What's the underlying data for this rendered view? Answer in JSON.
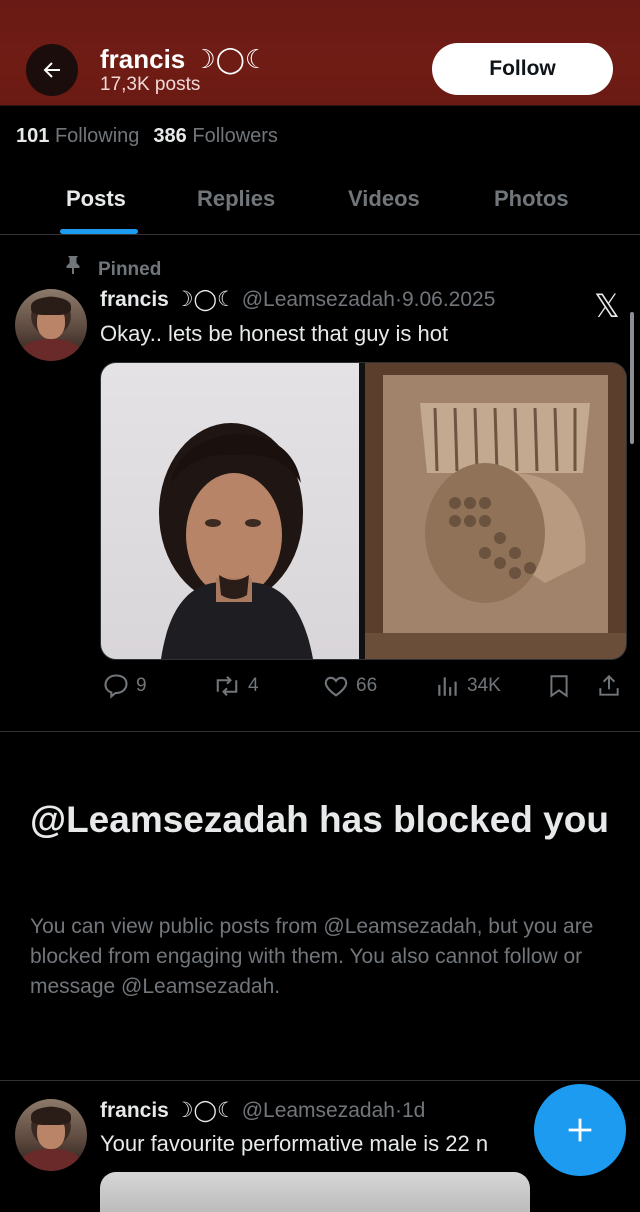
{
  "header": {
    "name": "francis ☽◯☾",
    "posts_count": "17,3K posts",
    "follow_label": "Follow",
    "background_color": "#6a1a14"
  },
  "stats": {
    "following_count": "101",
    "following_label": "Following",
    "followers_count": "386",
    "followers_label": "Followers"
  },
  "tabs": [
    {
      "label": "Posts",
      "active": true
    },
    {
      "label": "Replies",
      "active": false
    },
    {
      "label": "Videos",
      "active": false
    },
    {
      "label": "Photos",
      "active": false
    }
  ],
  "pinned_post": {
    "pinned_label": "Pinned",
    "author_name": "francis ☽◯☾",
    "handle": "@Leamsezadah",
    "separator": "·",
    "date": "9.06.2025",
    "text": "Okay.. lets be honest that guy is hot",
    "replies": "9",
    "reposts": "4",
    "likes": "66",
    "views": "34K"
  },
  "blocked": {
    "title": "@Leamsezadah has blocked you",
    "body": "You can view public posts from @Leamsezadah, but you are blocked from engaging with them. You also cannot follow or message @Leamsezadah."
  },
  "second_post": {
    "author_name": "francis ☽◯☾",
    "handle": "@Leamsezadah",
    "separator": "·",
    "date": "1d",
    "text": "Your favourite performative male is 22 n"
  },
  "icons": {
    "back": "arrow-left-icon",
    "pin": "pin-icon",
    "x_logo": "x-logo-icon",
    "reply": "reply-icon",
    "repost": "repost-icon",
    "like": "heart-icon",
    "views": "views-icon",
    "bookmark": "bookmark-icon",
    "share": "share-icon",
    "compose": "plus-icon"
  },
  "colors": {
    "accent": "#1d9bf0",
    "muted_text": "#71767b",
    "primary_text": "#e7e9ea"
  }
}
